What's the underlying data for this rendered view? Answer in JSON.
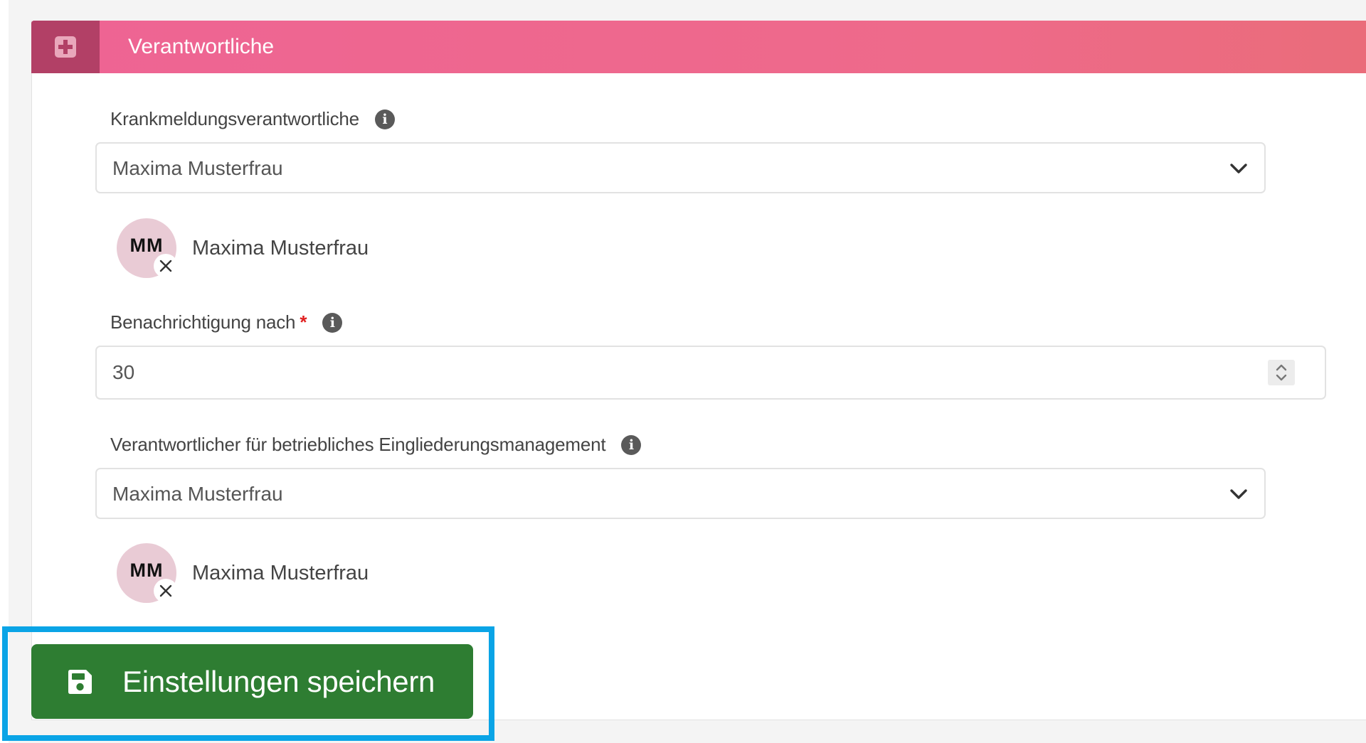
{
  "panel": {
    "title": "Verantwortliche",
    "header_icon": "plus-square-icon",
    "header_color": "#ee6494",
    "header_icon_bg": "#b24066"
  },
  "sick_leave": {
    "label": "Krankmeldungsverantwortliche",
    "selected_value": "Maxima Musterfrau",
    "chip": {
      "initials": "MM",
      "name": "Maxima Musterfrau"
    }
  },
  "notification": {
    "label": "Benachrichtigung nach",
    "required_marker": "*",
    "value": "30"
  },
  "bem": {
    "label": "Verantwortlicher für betriebliches Eingliederungsmanagement",
    "selected_value": "Maxima Musterfrau",
    "chip": {
      "initials": "MM",
      "name": "Maxima Musterfrau"
    }
  },
  "actions": {
    "save_label": "Einstellungen speichern",
    "save_icon": "floppy-disk-icon",
    "save_color": "#2e7d32",
    "highlight_color": "#0aa4e6"
  }
}
